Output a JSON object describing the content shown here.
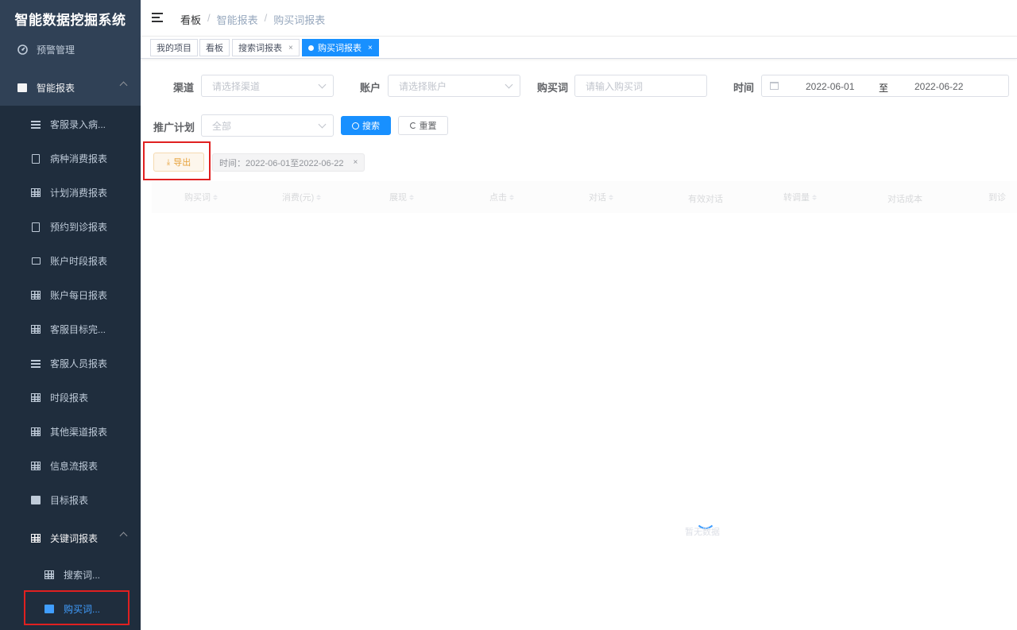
{
  "app": {
    "title": "智能数据挖掘系统"
  },
  "sidebar": {
    "top_items": [
      {
        "label": "预警管理",
        "icon": "dashboard-icon"
      },
      {
        "label": "智能报表",
        "icon": "report-icon"
      }
    ],
    "sub_items": [
      {
        "label": "客服录入病...",
        "icon": "list-icon"
      },
      {
        "label": "病种消费报表",
        "icon": "document-icon"
      },
      {
        "label": "计划消费报表",
        "icon": "table-icon"
      },
      {
        "label": "预约到诊报表",
        "icon": "copy-icon"
      },
      {
        "label": "账户时段报表",
        "icon": "chart-icon"
      },
      {
        "label": "账户每日报表",
        "icon": "table-icon"
      },
      {
        "label": "客服目标完...",
        "icon": "table-icon"
      },
      {
        "label": "客服人员报表",
        "icon": "list-icon"
      },
      {
        "label": "时段报表",
        "icon": "table-icon"
      },
      {
        "label": "其他渠道报表",
        "icon": "table-icon"
      },
      {
        "label": "信息流报表",
        "icon": "table-icon"
      },
      {
        "label": "目标报表",
        "icon": "book-icon"
      },
      {
        "label": "关键词报表",
        "icon": "table-icon"
      }
    ],
    "keyword_children": [
      {
        "label": "搜索词...",
        "icon": "table-icon"
      },
      {
        "label": "购买词...",
        "icon": "book-icon"
      }
    ]
  },
  "breadcrumb": {
    "first": "看板",
    "sep": "/",
    "second": "智能报表",
    "third": "购买词报表"
  },
  "tags": [
    {
      "label": "我的项目"
    },
    {
      "label": "看板"
    },
    {
      "label": "搜索词报表",
      "close": "×"
    },
    {
      "label": "购买词报表",
      "close": "×"
    }
  ],
  "filters": {
    "channel_label": "渠道",
    "channel_placeholder": "请选择渠道",
    "account_label": "账户",
    "account_placeholder": "请选择账户",
    "keyword_label": "购买词",
    "keyword_placeholder": "请输入购买词",
    "time_label": "时间",
    "date_start": "2022-06-01",
    "date_sep": "至",
    "date_end": "2022-06-22",
    "plan_label": "推广计划",
    "plan_value": "全部"
  },
  "buttons": {
    "search": "搜索",
    "reset": "重置",
    "export": "导出"
  },
  "filter_tag": {
    "text": "时间：2022-06-01至2022-06-22",
    "close": "×"
  },
  "table": {
    "columns": [
      "购买词",
      "消费(元)",
      "展现",
      "点击",
      "对话",
      "有效对话",
      "转调量",
      "对话成本",
      "到诊"
    ]
  },
  "empty_text": "暂无数据",
  "colors": {
    "sidebar_bg": "#304156",
    "submenu_bg": "#1f2d3d",
    "primary": "#1890ff",
    "active_text": "#409eff",
    "highlight_box": "#e02020"
  }
}
